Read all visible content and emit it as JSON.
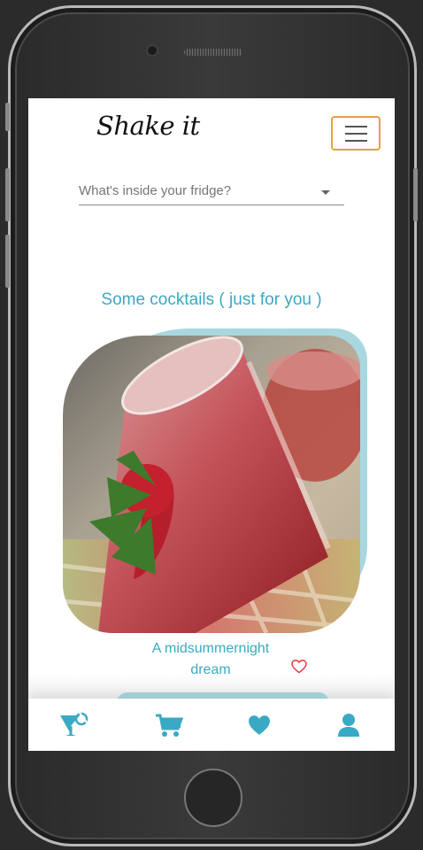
{
  "app": {
    "brand": "Shake it"
  },
  "search": {
    "placeholder": "What's inside your fridge?"
  },
  "section": {
    "title": "Some cocktails ( just for you )"
  },
  "cocktail": {
    "name_line1": "A midsummernight",
    "name_line2": "dream",
    "image_subject": "red strawberry cocktail glass with strawberry garnish"
  },
  "bottom_nav": {
    "items": [
      {
        "icon": "cocktail-icon"
      },
      {
        "icon": "cart-icon"
      },
      {
        "icon": "heart-icon"
      },
      {
        "icon": "user-icon"
      }
    ]
  },
  "colors": {
    "accent": "#3aa9c3",
    "card_backdrop": "#a9d7e0",
    "toggle_border": "#e5a23d",
    "favorite": "#e0383b"
  }
}
